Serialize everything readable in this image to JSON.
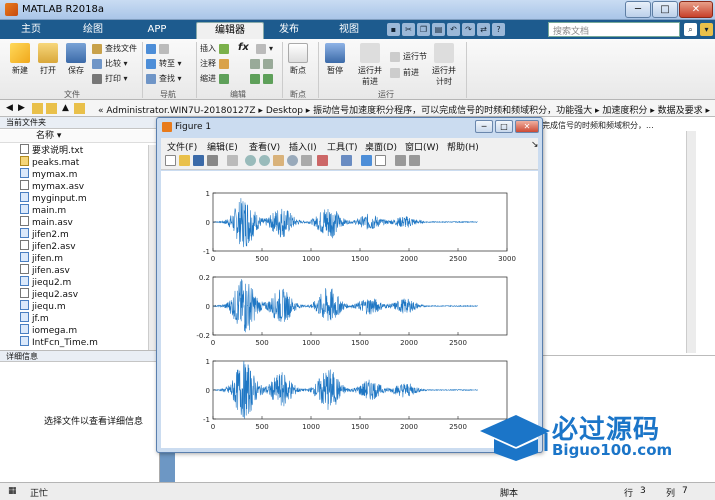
{
  "window": {
    "title": "MATLAB R2018a",
    "min": "─",
    "max": "□",
    "close": "✕"
  },
  "tabs": [
    "主页",
    "绘图",
    "APP",
    "编辑器",
    "发布",
    "视图"
  ],
  "search": {
    "placeholder": "搜索文档"
  },
  "ribbon": {
    "new": "新建",
    "open": "打开",
    "save": "保存",
    "find_files": "查找文件",
    "compare": "比较",
    "print": "打印",
    "goto": "转至",
    "find": "查找",
    "insert": "插入",
    "comment": "注释",
    "indent": "缩进",
    "fx": "fx",
    "breakpoint": "断点",
    "pause": "暂停",
    "run_and_advance": "运行并\n前进",
    "run_section": "运行节",
    "advance": "前进",
    "run_and_time": "运行并\n计时",
    "groups": {
      "file": "文件",
      "nav": "导航",
      "edit": "编辑",
      "bp": "断点",
      "run": "运行"
    }
  },
  "address": {
    "path": "« Administrator.WIN7U-20180127Z ▸ Desktop ▸ 振动信号加速度积分程序，可以完成信号的时频和频域积分，功能强大 ▸ 加速度积分 ▸ 数据及要求 ▸"
  },
  "file_panel": {
    "header": "当前文件夹",
    "column": "名称",
    "files": [
      {
        "name": "要求说明.txt",
        "kind": "txt"
      },
      {
        "name": "peaks.mat",
        "kind": "mat"
      },
      {
        "name": "mymax.m",
        "kind": "m"
      },
      {
        "name": "mymax.asv",
        "kind": "txt"
      },
      {
        "name": "myginput.m",
        "kind": "m"
      },
      {
        "name": "main.m",
        "kind": "m"
      },
      {
        "name": "main.asv",
        "kind": "txt"
      },
      {
        "name": "jifen2.m",
        "kind": "m"
      },
      {
        "name": "jifen2.asv",
        "kind": "txt"
      },
      {
        "name": "jifen.m",
        "kind": "m"
      },
      {
        "name": "jifen.asv",
        "kind": "txt"
      },
      {
        "name": "jiequ2.m",
        "kind": "m"
      },
      {
        "name": "jiequ2.asv",
        "kind": "txt"
      },
      {
        "name": "jiequ.m",
        "kind": "m"
      },
      {
        "name": "jf.m",
        "kind": "m"
      },
      {
        "name": "iomega.m",
        "kind": "m"
      },
      {
        "name": "IntFcn_Time.m",
        "kind": "m"
      }
    ],
    "details_header": "详细信息",
    "details_msg": "选择文件以查看详细信息"
  },
  "right_bg": {
    "text": "完成信号的时频和频域积分，..."
  },
  "status": {
    "mode": "正忙",
    "script": "脚本",
    "row_label": "行",
    "row": "3",
    "col_label": "列",
    "col": "7"
  },
  "figure": {
    "title": "Figure 1",
    "menu": [
      "文件(F)",
      "编辑(E)",
      "查看(V)",
      "插入(I)",
      "工具(T)",
      "桌面(D)",
      "窗口(W)",
      "帮助(H)"
    ],
    "colors": {
      "signal": "#1f77c4"
    }
  },
  "chart_data": [
    {
      "type": "line",
      "x_ticks": [
        "0",
        "500",
        "1000",
        "1500",
        "2000",
        "2500",
        "3000"
      ],
      "y_ticks": [
        "-1",
        "0",
        "1"
      ],
      "xlim": [
        0,
        3000
      ],
      "ylim": [
        -1,
        1
      ],
      "signal_x_range": [
        0,
        2700
      ],
      "bursts": [
        {
          "center": 320,
          "amp": 0.9
        },
        {
          "center": 700,
          "amp": 0.55
        },
        {
          "center": 1180,
          "amp": 0.6
        },
        {
          "center": 1600,
          "amp": 0.28
        },
        {
          "center": 1960,
          "amp": 0.2
        }
      ]
    },
    {
      "type": "line",
      "x_ticks": [
        "0",
        "500",
        "1000",
        "1500",
        "2000",
        "2500"
      ],
      "y_ticks": [
        "-0.2",
        "0",
        "0.2"
      ],
      "xlim": [
        0,
        3000
      ],
      "ylim": [
        -0.2,
        0.2
      ],
      "signal_x_range": [
        0,
        2700
      ],
      "bursts": [
        {
          "center": 320,
          "amp": 0.2
        },
        {
          "center": 700,
          "amp": 0.12
        },
        {
          "center": 1180,
          "amp": 0.13
        },
        {
          "center": 1600,
          "amp": 0.06
        },
        {
          "center": 1960,
          "amp": 0.05
        }
      ]
    },
    {
      "type": "line",
      "x_ticks": [
        "0",
        "500",
        "1000",
        "1500",
        "2000",
        "2500"
      ],
      "y_ticks": [
        "-1",
        "0",
        "1"
      ],
      "xlim": [
        0,
        3000
      ],
      "ylim": [
        -1,
        1
      ],
      "signal_x_range": [
        0,
        2700
      ],
      "bursts": [
        {
          "center": 320,
          "amp": 1.0
        },
        {
          "center": 700,
          "amp": 0.6
        },
        {
          "center": 1180,
          "amp": 0.75
        },
        {
          "center": 1600,
          "amp": 0.35
        },
        {
          "center": 1960,
          "amp": 0.25
        }
      ]
    }
  ],
  "watermark": {
    "line1": "必过源码",
    "line2": "Biguo100.com"
  }
}
